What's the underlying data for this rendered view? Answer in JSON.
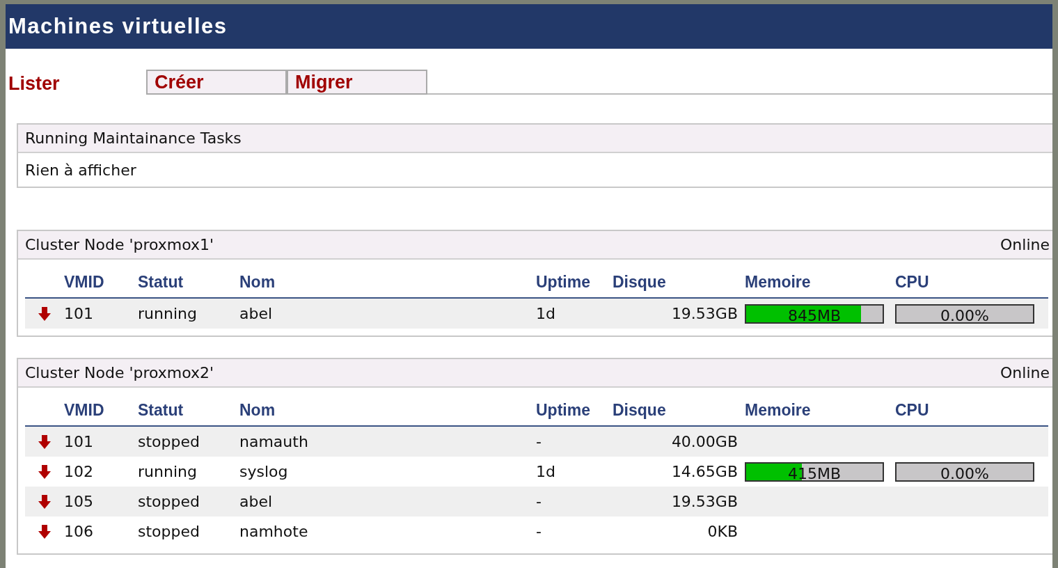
{
  "window": {
    "title": "Machines virtuelles"
  },
  "tabs": [
    {
      "label": "Lister",
      "selected": true
    },
    {
      "label": "Créer",
      "selected": false
    },
    {
      "label": "Migrer",
      "selected": false
    }
  ],
  "tasks": {
    "title": "Running Maintainance Tasks",
    "message": "Rien à afficher"
  },
  "nodes": [
    {
      "title": "Cluster Node 'proxmox1'",
      "status": "Online",
      "columns": [
        "VMID",
        "Statut",
        "Nom",
        "Uptime",
        "Disque",
        "Memoire",
        "CPU"
      ],
      "rows": [
        {
          "vmid": "101",
          "status": "running",
          "name": "abel",
          "uptime": "1d",
          "disk": "19.53GB",
          "memory": {
            "reading": "845MB",
            "level": 0.84
          },
          "cpu": {
            "reading": "0.00%",
            "level": 0
          }
        }
      ]
    },
    {
      "title": "Cluster Node 'proxmox2'",
      "status": "Online",
      "columns": [
        "VMID",
        "Statut",
        "Nom",
        "Uptime",
        "Disque",
        "Memoire",
        "CPU"
      ],
      "rows": [
        {
          "vmid": "101",
          "status": "stopped",
          "name": "namauth",
          "uptime": "-",
          "disk": "40.00GB"
        },
        {
          "vmid": "102",
          "status": "running",
          "name": "syslog",
          "uptime": "1d",
          "disk": "14.65GB",
          "memory": {
            "reading": "415MB",
            "level": 0.41
          },
          "cpu": {
            "reading": "0.00%",
            "level": 0
          }
        },
        {
          "vmid": "105",
          "status": "stopped",
          "name": "abel",
          "uptime": "-",
          "disk": "19.53GB"
        },
        {
          "vmid": "106",
          "status": "stopped",
          "name": "namhote",
          "uptime": "-",
          "disk": "0KB"
        }
      ]
    }
  ]
}
